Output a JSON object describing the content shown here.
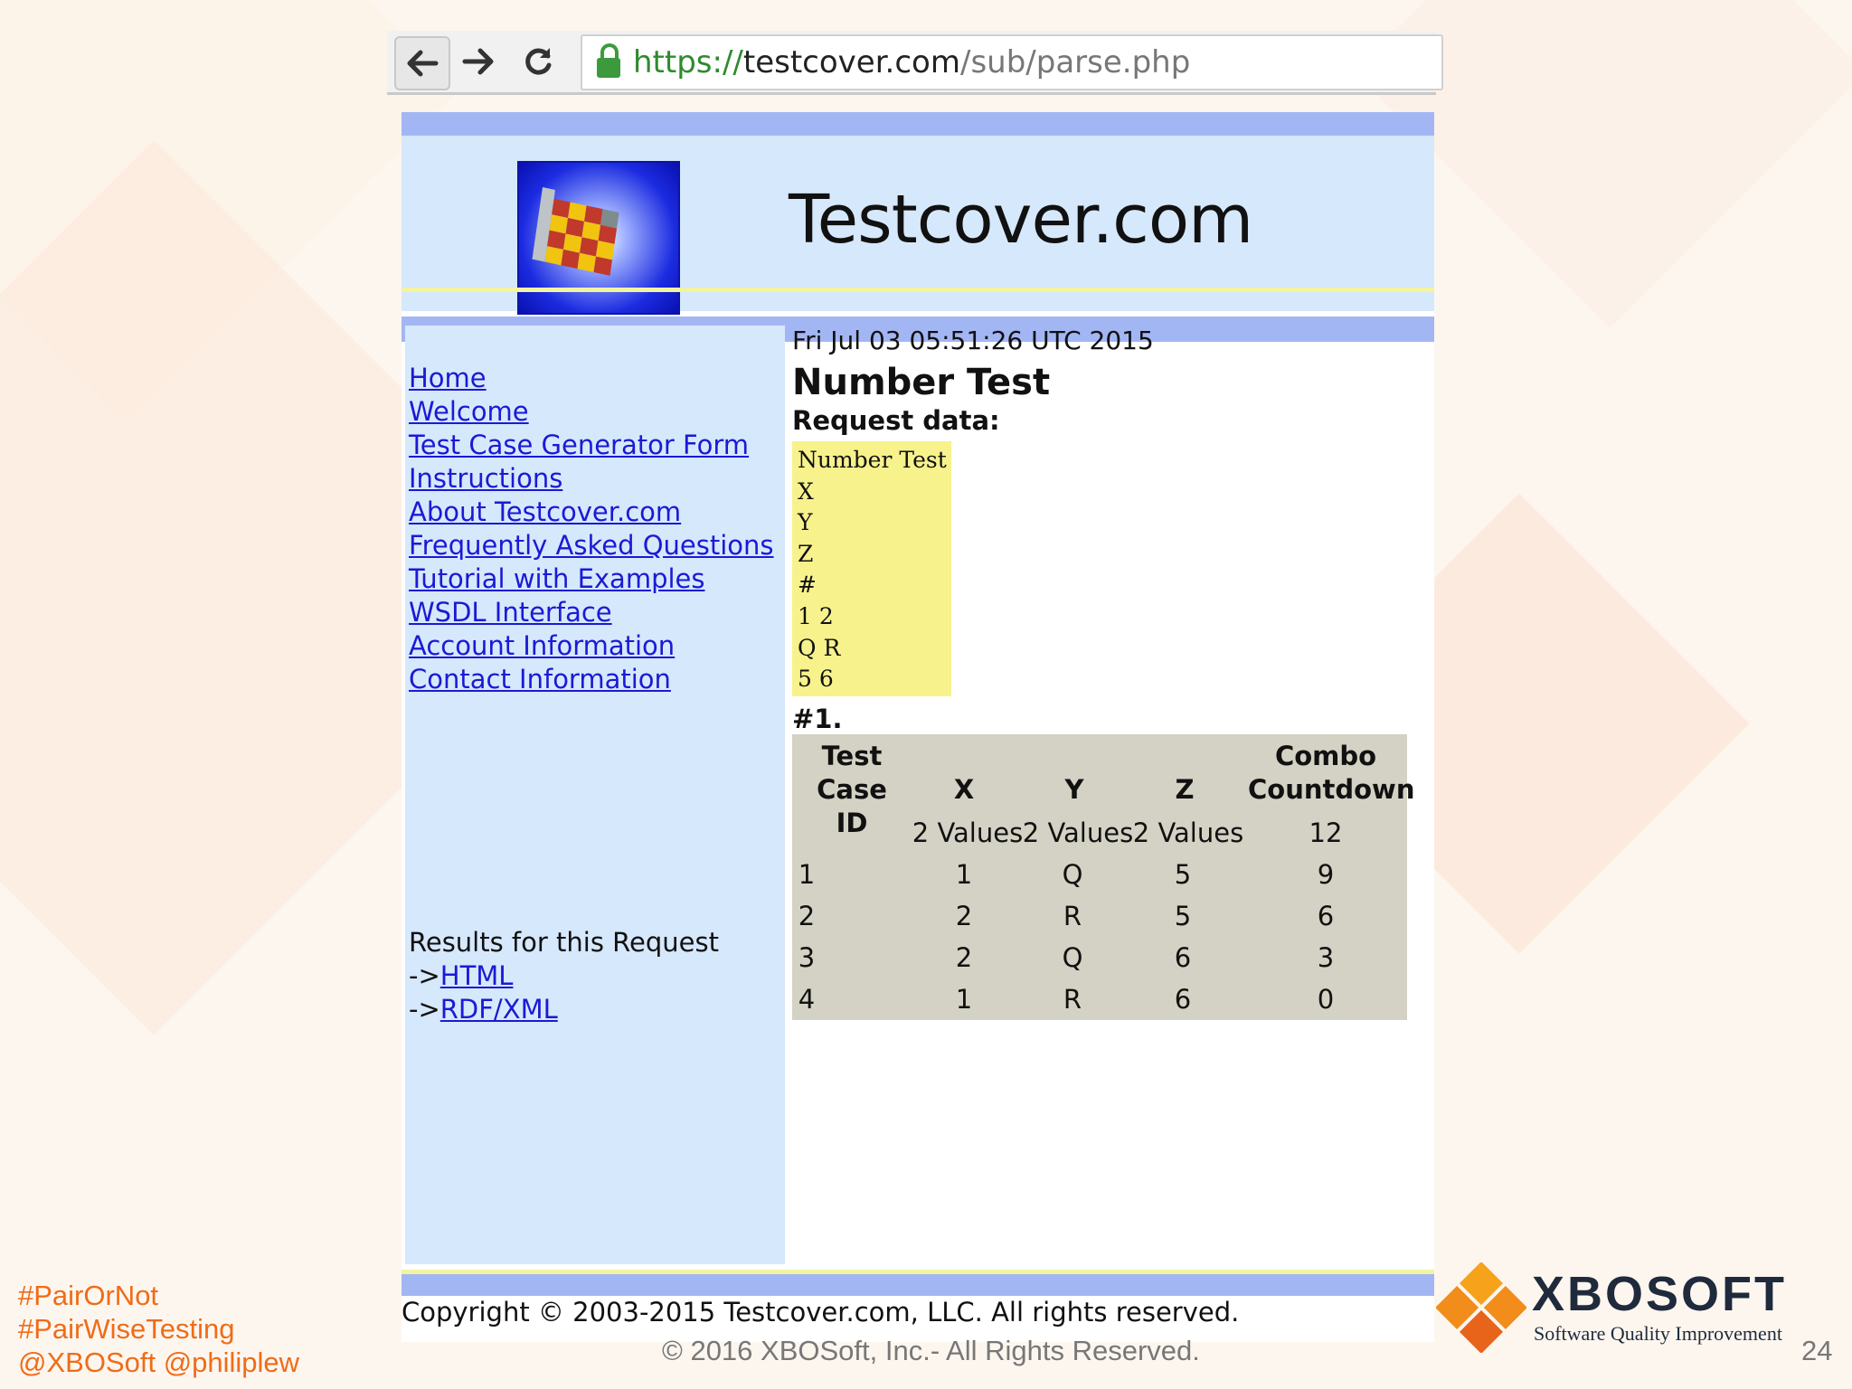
{
  "browser": {
    "url_scheme": "https://",
    "url_host": "testcover.com",
    "url_path": "/sub/parse.php",
    "lock_icon": "lock-icon",
    "secure_color": "#2e8b2e"
  },
  "site": {
    "title": "Testcover.com",
    "colors": {
      "band": "#a3b6f4",
      "panel": "#d6e8fb",
      "link": "#1a1ad6",
      "request_box": "#f7f28c",
      "table_bg": "#d4d2c4"
    }
  },
  "nav": {
    "links": [
      "Home",
      "Welcome",
      "Test Case Generator Form",
      "Instructions",
      "About Testcover.com",
      "Frequently Asked Questions",
      "Tutorial with Examples",
      "WSDL Interface",
      "Account Information",
      "Contact Information"
    ]
  },
  "results": {
    "label": "Results for this Request",
    "prefix": "->",
    "html_link": "HTML",
    "rdf_link": "RDF/XML"
  },
  "content": {
    "timestamp": "Fri Jul 03 05:51:26 UTC 2015",
    "heading": "Number Test",
    "request_label": "Request data:",
    "request_lines": [
      "Number Test",
      "X",
      "Y",
      "Z",
      "#",
      "1 2",
      "Q R",
      "5 6"
    ],
    "set_label": "#1."
  },
  "table": {
    "headers": {
      "test_line1": "Test",
      "test_line2": "Case ID",
      "x": "X",
      "y": "Y",
      "z": "Z",
      "combo_line1": "Combo",
      "combo_line2": "Countdown"
    },
    "values_row": {
      "x": "2 Values",
      "y": "2 Values",
      "z": "2 Values",
      "countdown": "12"
    },
    "rows": [
      {
        "id": "1",
        "x": "1",
        "y": "Q",
        "z": "5",
        "countdown": "9"
      },
      {
        "id": "2",
        "x": "2",
        "y": "R",
        "z": "5",
        "countdown": "6"
      },
      {
        "id": "3",
        "x": "2",
        "y": "Q",
        "z": "6",
        "countdown": "3"
      },
      {
        "id": "4",
        "x": "1",
        "y": "R",
        "z": "6",
        "countdown": "0"
      }
    ]
  },
  "page_footer": {
    "copyright": "Copyright © 2003-2015 Testcover.com, LLC. All rights reserved."
  },
  "slide": {
    "hashtags": [
      "#PairOrNot",
      "#PairWiseTesting",
      "@XBOSoft @philiplew"
    ],
    "copyright": "© 2016 XBOSoft, Inc.- All Rights Reserved.",
    "page_number": "24",
    "brand_name": "XBOSOFT",
    "brand_tagline": "Software Quality Improvement",
    "accent_color": "#ef6c17"
  }
}
